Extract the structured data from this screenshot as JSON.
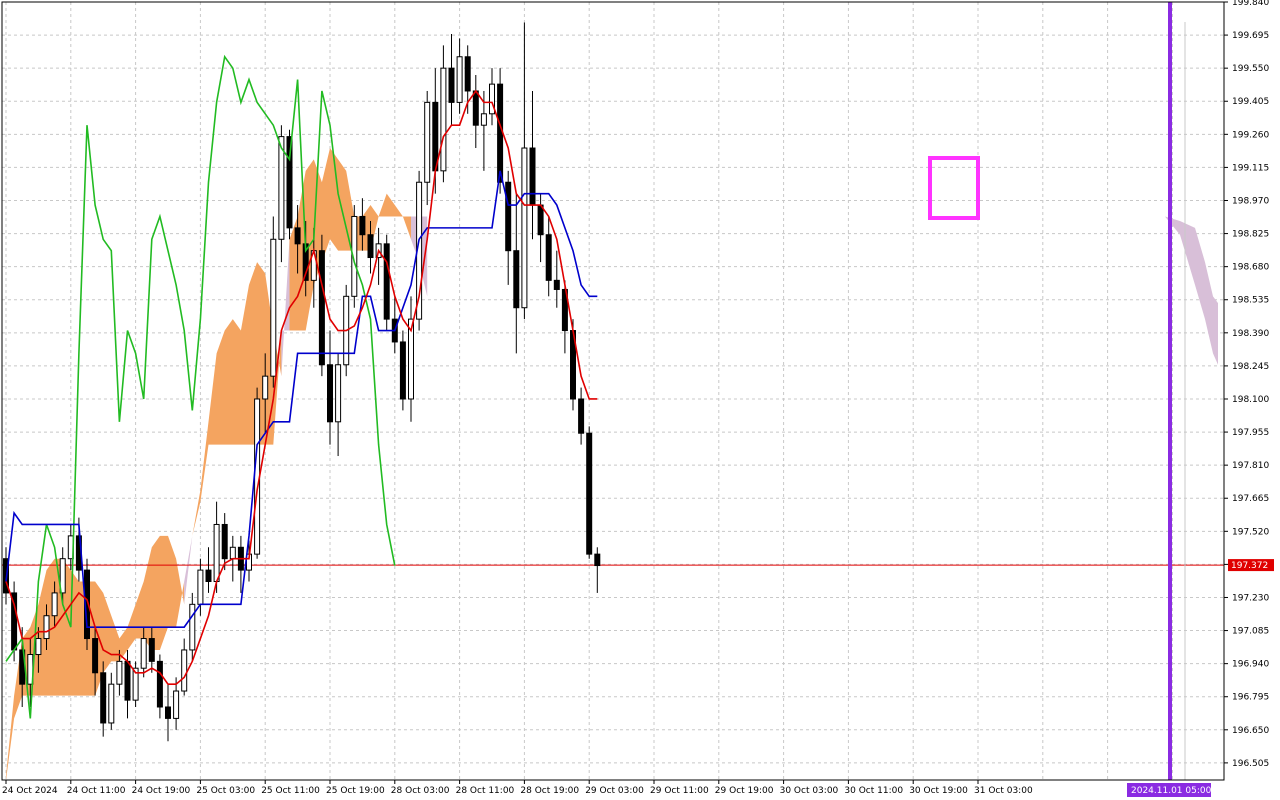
{
  "chart_data": {
    "type": "candlestick",
    "indicator": "ichimoku",
    "x_tick_labels": [
      "24 Oct 2024",
      "24 Oct 11:00",
      "24 Oct 19:00",
      "25 Oct 03:00",
      "25 Oct 11:00",
      "25 Oct 19:00",
      "28 Oct 03:00",
      "28 Oct 11:00",
      "28 Oct 19:00",
      "29 Oct 03:00",
      "29 Oct 11:00",
      "29 Oct 19:00",
      "30 Oct 03:00",
      "30 Oct 11:00",
      "30 Oct 19:00",
      "31 Oct 03:00"
    ],
    "y_tick_labels": [
      "199.840",
      "199.695",
      "199.550",
      "199.405",
      "199.260",
      "199.115",
      "198.970",
      "198.825",
      "198.680",
      "198.535",
      "198.390",
      "198.245",
      "198.100",
      "197.955",
      "197.810",
      "197.665",
      "197.520",
      "197.375",
      "197.230",
      "197.085",
      "196.940",
      "196.795",
      "196.650",
      "196.505"
    ],
    "ylim": [
      196.43,
      199.84
    ],
    "grid": true,
    "current_price": 197.372,
    "current_price_label": "197.372",
    "future_time_label": "2024.11.01 05:00",
    "colors": {
      "candle": "#000000",
      "bull_body": "#ffffff",
      "bear_body": "#000000",
      "tenkan": "#e00000",
      "kijun": "#0000cc",
      "chikou": "#22bb22",
      "kumo_bull": "#f4a460",
      "kumo_bear": "#d8bfd8",
      "price_line": "#e00000",
      "marker": "#8a2be2",
      "highlight_box": "#ff33ff"
    },
    "candles": [
      [
        197.4,
        197.45,
        197.2,
        197.25
      ],
      [
        197.25,
        197.3,
        196.95,
        197.0
      ],
      [
        197.0,
        197.1,
        196.75,
        196.85
      ],
      [
        196.85,
        197.05,
        196.75,
        196.98
      ],
      [
        196.98,
        197.1,
        196.9,
        197.05
      ],
      [
        197.05,
        197.2,
        197.0,
        197.15
      ],
      [
        197.15,
        197.3,
        197.1,
        197.25
      ],
      [
        197.25,
        197.45,
        197.2,
        197.4
      ],
      [
        197.4,
        197.55,
        197.35,
        197.5
      ],
      [
        197.5,
        197.58,
        197.3,
        197.35
      ],
      [
        197.35,
        197.4,
        197.0,
        197.05
      ],
      [
        197.05,
        197.1,
        196.8,
        196.9
      ],
      [
        196.9,
        196.95,
        196.62,
        196.68
      ],
      [
        196.68,
        196.9,
        196.65,
        196.85
      ],
      [
        196.85,
        197.0,
        196.8,
        196.95
      ],
      [
        196.95,
        197.0,
        196.7,
        196.78
      ],
      [
        196.78,
        196.95,
        196.75,
        196.92
      ],
      [
        196.92,
        197.1,
        196.88,
        197.05
      ],
      [
        197.05,
        197.1,
        196.9,
        196.95
      ],
      [
        196.95,
        196.98,
        196.7,
        196.75
      ],
      [
        196.75,
        196.85,
        196.6,
        196.7
      ],
      [
        196.7,
        196.88,
        196.65,
        196.82
      ],
      [
        196.82,
        197.05,
        196.8,
        197.0
      ],
      [
        197.0,
        197.25,
        196.95,
        197.2
      ],
      [
        197.2,
        197.4,
        197.15,
        197.35
      ],
      [
        197.35,
        197.45,
        197.25,
        197.3
      ],
      [
        197.3,
        197.65,
        197.25,
        197.55
      ],
      [
        197.55,
        197.6,
        197.35,
        197.4
      ],
      [
        197.4,
        197.5,
        197.3,
        197.45
      ],
      [
        197.45,
        197.5,
        197.25,
        197.35
      ],
      [
        197.35,
        197.48,
        197.3,
        197.42
      ],
      [
        197.42,
        198.15,
        197.4,
        198.1
      ],
      [
        198.1,
        198.3,
        197.95,
        198.2
      ],
      [
        198.2,
        198.9,
        198.15,
        198.8
      ],
      [
        198.8,
        199.3,
        198.7,
        199.25
      ],
      [
        199.25,
        199.28,
        198.8,
        198.85
      ],
      [
        198.85,
        198.95,
        198.65,
        198.78
      ],
      [
        198.78,
        198.88,
        198.55,
        198.62
      ],
      [
        198.62,
        198.85,
        198.5,
        198.75
      ],
      [
        198.75,
        198.82,
        198.2,
        198.25
      ],
      [
        198.25,
        198.4,
        197.9,
        198.0
      ],
      [
        198.0,
        198.3,
        197.85,
        198.25
      ],
      [
        198.25,
        198.6,
        198.2,
        198.55
      ],
      [
        198.55,
        198.95,
        198.5,
        198.9
      ],
      [
        198.9,
        198.98,
        198.75,
        198.82
      ],
      [
        198.82,
        198.88,
        198.65,
        198.72
      ],
      [
        198.72,
        198.85,
        198.6,
        198.78
      ],
      [
        198.78,
        198.82,
        198.4,
        198.45
      ],
      [
        198.45,
        198.55,
        198.3,
        198.35
      ],
      [
        198.35,
        198.4,
        198.05,
        198.1
      ],
      [
        198.1,
        198.55,
        198.0,
        198.45
      ],
      [
        198.45,
        199.1,
        198.4,
        199.05
      ],
      [
        199.05,
        199.45,
        198.95,
        199.4
      ],
      [
        199.4,
        199.55,
        199.0,
        199.1
      ],
      [
        199.1,
        199.65,
        199.05,
        199.55
      ],
      [
        199.55,
        199.7,
        199.3,
        199.4
      ],
      [
        199.4,
        199.68,
        199.35,
        199.6
      ],
      [
        199.6,
        199.65,
        199.35,
        199.45
      ],
      [
        199.45,
        199.52,
        199.2,
        199.3
      ],
      [
        199.3,
        199.45,
        199.1,
        199.35
      ],
      [
        199.35,
        199.55,
        199.3,
        199.48
      ],
      [
        199.48,
        199.55,
        199.0,
        199.05
      ],
      [
        199.05,
        199.1,
        198.6,
        198.75
      ],
      [
        198.75,
        199.0,
        198.3,
        198.5
      ],
      [
        198.5,
        199.75,
        198.45,
        199.2
      ],
      [
        199.2,
        199.45,
        198.8,
        198.95
      ],
      [
        198.95,
        199.0,
        198.7,
        198.82
      ],
      [
        198.82,
        198.9,
        198.55,
        198.62
      ],
      [
        198.62,
        198.75,
        198.5,
        198.58
      ],
      [
        198.58,
        198.62,
        198.3,
        198.4
      ],
      [
        198.4,
        198.45,
        198.05,
        198.1
      ],
      [
        198.1,
        198.15,
        197.9,
        197.95
      ],
      [
        197.95,
        197.98,
        197.4,
        197.42
      ],
      [
        197.42,
        197.45,
        197.25,
        197.37
      ]
    ],
    "tenkan_sen": [
      197.3,
      197.2,
      197.05,
      197.05,
      197.08,
      197.08,
      197.1,
      197.15,
      197.2,
      197.25,
      197.22,
      197.1,
      197.0,
      196.98,
      196.98,
      196.95,
      196.9,
      196.9,
      196.92,
      196.9,
      196.85,
      196.85,
      196.88,
      196.95,
      197.05,
      197.15,
      197.3,
      197.38,
      197.4,
      197.4,
      197.4,
      197.7,
      197.9,
      198.1,
      198.4,
      198.5,
      198.55,
      198.65,
      198.75,
      198.6,
      198.45,
      198.4,
      198.4,
      198.42,
      198.5,
      198.6,
      198.75,
      198.7,
      198.55,
      198.45,
      198.4,
      198.55,
      198.8,
      199.1,
      199.25,
      199.3,
      199.3,
      199.4,
      199.45,
      199.4,
      199.4,
      199.3,
      199.2,
      199.0,
      198.95,
      198.95,
      198.95,
      198.9,
      198.8,
      198.6,
      198.4,
      198.2,
      198.1,
      198.1
    ],
    "kijun_sen": [
      197.3,
      197.6,
      197.55,
      197.55,
      197.55,
      197.55,
      197.55,
      197.55,
      197.55,
      197.55,
      197.1,
      197.1,
      197.1,
      197.1,
      197.1,
      197.1,
      197.1,
      197.1,
      197.1,
      197.1,
      197.1,
      197.1,
      197.1,
      197.15,
      197.2,
      197.2,
      197.2,
      197.2,
      197.2,
      197.2,
      197.5,
      197.9,
      197.95,
      198.0,
      198.0,
      198.0,
      198.3,
      198.3,
      198.3,
      198.3,
      198.3,
      198.3,
      198.3,
      198.3,
      198.55,
      198.55,
      198.4,
      198.4,
      198.4,
      198.5,
      198.6,
      198.8,
      198.85,
      198.85,
      198.85,
      198.85,
      198.85,
      198.85,
      198.85,
      198.85,
      198.85,
      199.1,
      198.95,
      198.95,
      199.0,
      199.0,
      199.0,
      199.0,
      198.95,
      198.85,
      198.75,
      198.6,
      198.55,
      198.55
    ],
    "chikou_span": [
      196.95,
      197.0,
      197.05,
      196.7,
      197.3,
      197.55,
      197.45,
      197.2,
      197.1,
      198.3,
      199.3,
      198.95,
      198.8,
      198.75,
      198.0,
      198.4,
      198.3,
      198.1,
      198.8,
      198.9,
      198.75,
      198.6,
      198.4,
      198.05,
      198.45,
      199.05,
      199.4,
      199.6,
      199.55,
      199.4,
      199.5,
      199.4,
      199.35,
      199.3,
      199.2,
      199.15,
      199.5,
      198.75,
      198.8,
      199.45,
      199.3,
      199.0,
      198.85,
      198.7,
      198.6,
      198.45,
      197.9,
      197.55,
      197.37
    ],
    "kumo_span_a": [
      196.45,
      196.8,
      197.05,
      197.1,
      197.2,
      197.35,
      197.4,
      197.4,
      197.35,
      197.3,
      197.3,
      197.3,
      197.25,
      197.15,
      197.05,
      197.1,
      197.2,
      197.3,
      197.45,
      197.5,
      197.5,
      197.4,
      197.2,
      197.5,
      197.7,
      198.0,
      198.3,
      198.4,
      198.45,
      198.4,
      198.6,
      198.7,
      198.65,
      198.4,
      198.2,
      198.8,
      198.9,
      199.1,
      199.15,
      199.05,
      199.2,
      199.15,
      199.1,
      198.9,
      198.9,
      198.95,
      198.9,
      199.0,
      198.95,
      198.9,
      198.8,
      198.7,
      198.55
    ],
    "kumo_span_b": [
      196.43,
      196.7,
      196.8,
      196.8,
      196.8,
      196.8,
      196.8,
      196.8,
      196.8,
      196.8,
      196.8,
      196.8,
      196.9,
      196.95,
      196.95,
      197.0,
      197.05,
      197.05,
      197.0,
      197.0,
      197.1,
      197.1,
      197.3,
      197.5,
      197.65,
      197.9,
      197.9,
      197.9,
      197.9,
      197.9,
      197.9,
      197.9,
      197.9,
      197.9,
      198.4,
      198.4,
      198.4,
      198.4,
      198.6,
      198.7,
      198.8,
      198.75,
      198.75,
      198.75,
      198.75,
      198.75,
      198.9,
      198.9,
      198.9,
      198.9,
      198.9,
      198.9,
      198.9
    ]
  }
}
